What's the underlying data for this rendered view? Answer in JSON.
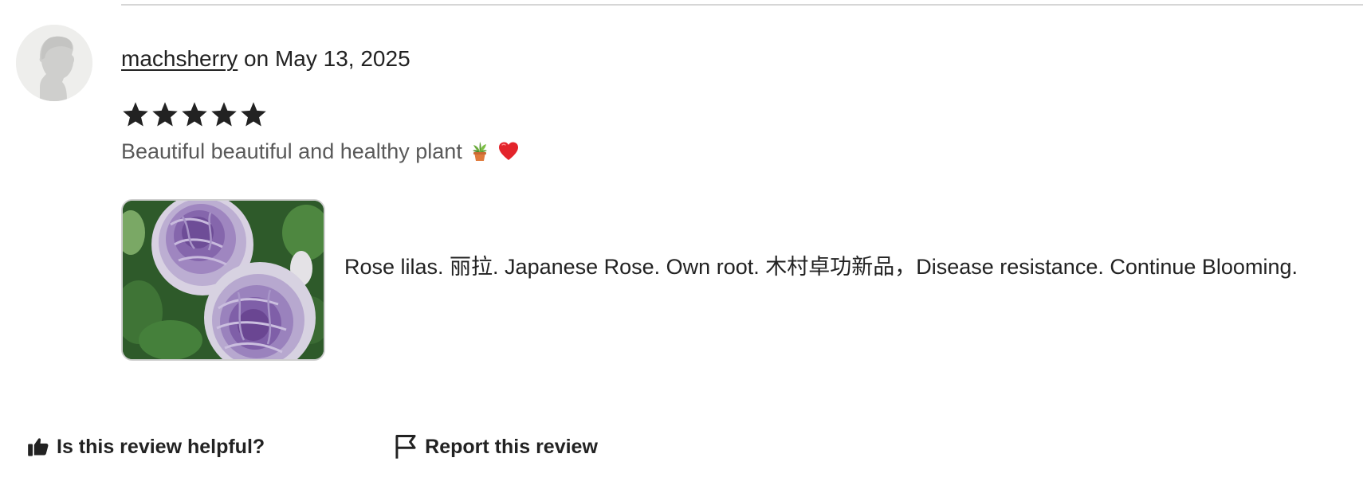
{
  "review": {
    "username": "machsherry",
    "date_text": " on May 13, 2025",
    "rating": 5,
    "text": "Beautiful beautiful and healthy plant",
    "emojis": [
      "potted-plant-emoji",
      "red-heart-emoji"
    ],
    "photo": {
      "icon": "rose-photo-thumbnail",
      "caption": "Rose lilas. 丽拉. Japanese Rose. Own root. 木村卓功新品，Disease resistance. Continue Blooming."
    }
  },
  "actions": {
    "helpful_label": "Is this review helpful?",
    "report_label": "Report this review"
  },
  "colors": {
    "text": "#222222",
    "muted_text": "#595959",
    "divider": "#d6d6d6",
    "avatar_bg": "#eeeeec"
  }
}
